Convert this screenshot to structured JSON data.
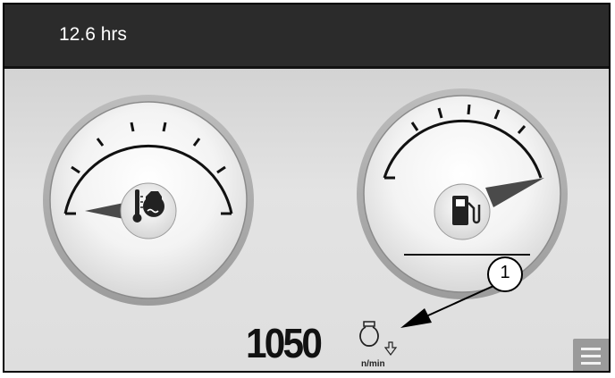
{
  "header": {
    "engine_hours": "12.6 hrs"
  },
  "gauges": {
    "coolant_temperature": {
      "icon": "coolant-temperature-icon",
      "level": 0.0
    },
    "fuel": {
      "icon": "fuel-pump-icon",
      "level": 1.0
    }
  },
  "engine_speed": {
    "value": "1050",
    "unit": "n/min",
    "icon": "engine-speed-down-icon"
  },
  "callout": {
    "number": "1"
  },
  "menu": {
    "icon": "hamburger-menu-icon"
  }
}
